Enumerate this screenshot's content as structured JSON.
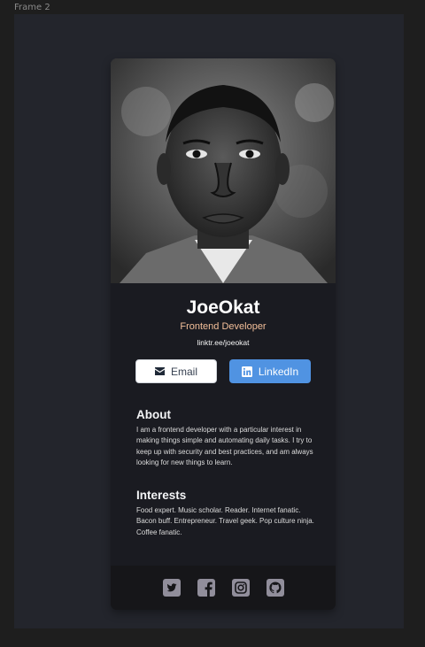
{
  "frame": {
    "label": "Frame 2"
  },
  "profile": {
    "name": "JoeOkat",
    "role": "Frontend Developer",
    "link": "linktr.ee/joeokat"
  },
  "buttons": {
    "email_label": "Email",
    "email_icon": "envelope-icon",
    "linkedin_label": "LinkedIn",
    "linkedin_icon": "linkedin-icon"
  },
  "about": {
    "title": "About",
    "text": "I am a frontend developer with a particular interest in making things simple and automating daily tasks. I try to keep up with security and best practices, and am always looking for new things to learn."
  },
  "interests": {
    "title": "Interests",
    "text": "Food expert. Music scholar. Reader. Internet fanatic. Bacon buff. Entrepreneur. Travel geek. Pop culture ninja. Coffee fanatic."
  },
  "footer": {
    "icons": [
      "twitter-icon",
      "facebook-icon",
      "instagram-icon",
      "github-icon"
    ]
  },
  "colors": {
    "page_bg": "#1e1e1e",
    "frame_bg": "#23252c",
    "card_bg": "#1a1b21",
    "footer_bg": "#161619",
    "role_accent": "#f3bf99",
    "linkedin_blue": "#5093e2",
    "social_icon": "#918e9b"
  }
}
